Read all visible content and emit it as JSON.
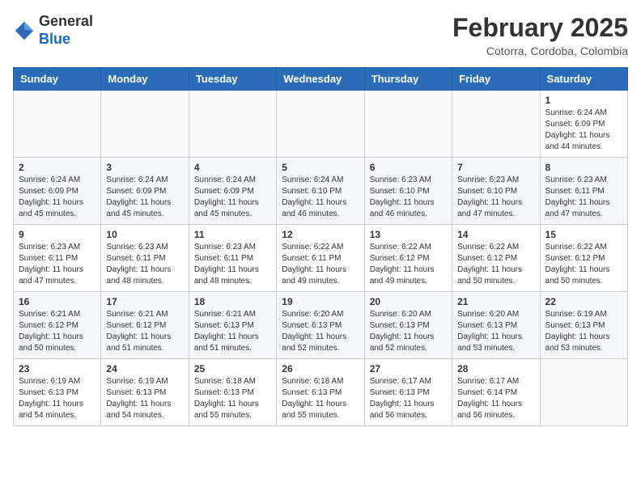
{
  "header": {
    "logo_line1": "General",
    "logo_line2": "Blue",
    "month_year": "February 2025",
    "location": "Cotorra, Cordoba, Colombia"
  },
  "days_of_week": [
    "Sunday",
    "Monday",
    "Tuesday",
    "Wednesday",
    "Thursday",
    "Friday",
    "Saturday"
  ],
  "weeks": [
    [
      {
        "day": "",
        "info": ""
      },
      {
        "day": "",
        "info": ""
      },
      {
        "day": "",
        "info": ""
      },
      {
        "day": "",
        "info": ""
      },
      {
        "day": "",
        "info": ""
      },
      {
        "day": "",
        "info": ""
      },
      {
        "day": "1",
        "info": "Sunrise: 6:24 AM\nSunset: 6:09 PM\nDaylight: 11 hours\nand 44 minutes."
      }
    ],
    [
      {
        "day": "2",
        "info": "Sunrise: 6:24 AM\nSunset: 6:09 PM\nDaylight: 11 hours\nand 45 minutes."
      },
      {
        "day": "3",
        "info": "Sunrise: 6:24 AM\nSunset: 6:09 PM\nDaylight: 11 hours\nand 45 minutes."
      },
      {
        "day": "4",
        "info": "Sunrise: 6:24 AM\nSunset: 6:09 PM\nDaylight: 11 hours\nand 45 minutes."
      },
      {
        "day": "5",
        "info": "Sunrise: 6:24 AM\nSunset: 6:10 PM\nDaylight: 11 hours\nand 46 minutes."
      },
      {
        "day": "6",
        "info": "Sunrise: 6:23 AM\nSunset: 6:10 PM\nDaylight: 11 hours\nand 46 minutes."
      },
      {
        "day": "7",
        "info": "Sunrise: 6:23 AM\nSunset: 6:10 PM\nDaylight: 11 hours\nand 47 minutes."
      },
      {
        "day": "8",
        "info": "Sunrise: 6:23 AM\nSunset: 6:11 PM\nDaylight: 11 hours\nand 47 minutes."
      }
    ],
    [
      {
        "day": "9",
        "info": "Sunrise: 6:23 AM\nSunset: 6:11 PM\nDaylight: 11 hours\nand 47 minutes."
      },
      {
        "day": "10",
        "info": "Sunrise: 6:23 AM\nSunset: 6:11 PM\nDaylight: 11 hours\nand 48 minutes."
      },
      {
        "day": "11",
        "info": "Sunrise: 6:23 AM\nSunset: 6:11 PM\nDaylight: 11 hours\nand 48 minutes."
      },
      {
        "day": "12",
        "info": "Sunrise: 6:22 AM\nSunset: 6:11 PM\nDaylight: 11 hours\nand 49 minutes."
      },
      {
        "day": "13",
        "info": "Sunrise: 6:22 AM\nSunset: 6:12 PM\nDaylight: 11 hours\nand 49 minutes."
      },
      {
        "day": "14",
        "info": "Sunrise: 6:22 AM\nSunset: 6:12 PM\nDaylight: 11 hours\nand 50 minutes."
      },
      {
        "day": "15",
        "info": "Sunrise: 6:22 AM\nSunset: 6:12 PM\nDaylight: 11 hours\nand 50 minutes."
      }
    ],
    [
      {
        "day": "16",
        "info": "Sunrise: 6:21 AM\nSunset: 6:12 PM\nDaylight: 11 hours\nand 50 minutes."
      },
      {
        "day": "17",
        "info": "Sunrise: 6:21 AM\nSunset: 6:12 PM\nDaylight: 11 hours\nand 51 minutes."
      },
      {
        "day": "18",
        "info": "Sunrise: 6:21 AM\nSunset: 6:13 PM\nDaylight: 11 hours\nand 51 minutes."
      },
      {
        "day": "19",
        "info": "Sunrise: 6:20 AM\nSunset: 6:13 PM\nDaylight: 11 hours\nand 52 minutes."
      },
      {
        "day": "20",
        "info": "Sunrise: 6:20 AM\nSunset: 6:13 PM\nDaylight: 11 hours\nand 52 minutes."
      },
      {
        "day": "21",
        "info": "Sunrise: 6:20 AM\nSunset: 6:13 PM\nDaylight: 11 hours\nand 53 minutes."
      },
      {
        "day": "22",
        "info": "Sunrise: 6:19 AM\nSunset: 6:13 PM\nDaylight: 11 hours\nand 53 minutes."
      }
    ],
    [
      {
        "day": "23",
        "info": "Sunrise: 6:19 AM\nSunset: 6:13 PM\nDaylight: 11 hours\nand 54 minutes."
      },
      {
        "day": "24",
        "info": "Sunrise: 6:19 AM\nSunset: 6:13 PM\nDaylight: 11 hours\nand 54 minutes."
      },
      {
        "day": "25",
        "info": "Sunrise: 6:18 AM\nSunset: 6:13 PM\nDaylight: 11 hours\nand 55 minutes."
      },
      {
        "day": "26",
        "info": "Sunrise: 6:18 AM\nSunset: 6:13 PM\nDaylight: 11 hours\nand 55 minutes."
      },
      {
        "day": "27",
        "info": "Sunrise: 6:17 AM\nSunset: 6:13 PM\nDaylight: 11 hours\nand 56 minutes."
      },
      {
        "day": "28",
        "info": "Sunrise: 6:17 AM\nSunset: 6:14 PM\nDaylight: 11 hours\nand 56 minutes."
      },
      {
        "day": "",
        "info": ""
      }
    ]
  ]
}
